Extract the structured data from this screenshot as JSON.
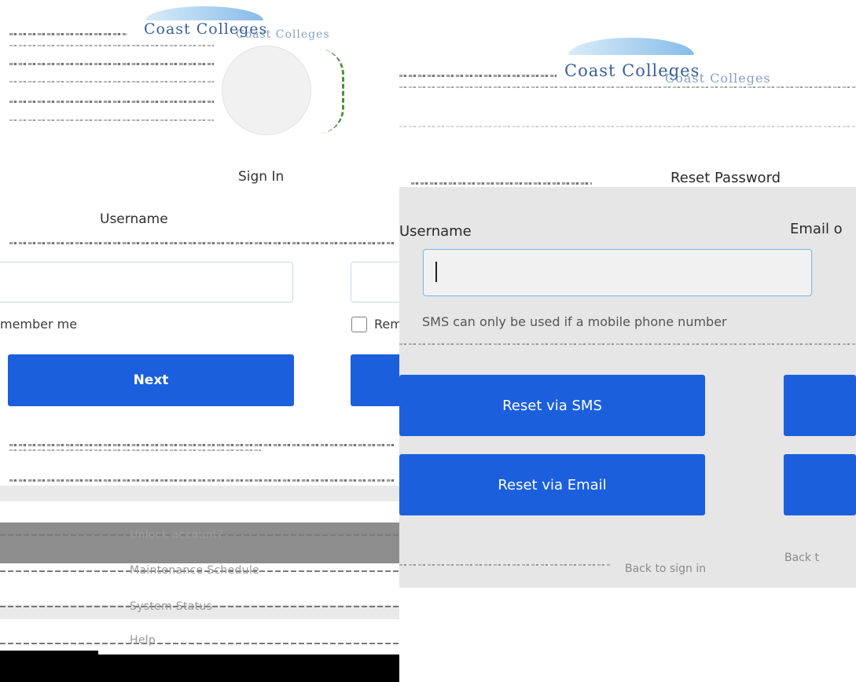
{
  "left": {
    "logo_text": "Coast Colleges",
    "logo_echo": "Coast Colleges",
    "heading": "Sign In",
    "username_label": "Username",
    "remember_text": "member me",
    "remember_text_2": "Rem",
    "next_label": "Next",
    "footer_links": [
      "Unlock account?",
      "Maintenance Schedule",
      "System Status",
      "Help"
    ]
  },
  "right": {
    "logo_text": "Coast Colleges",
    "logo_echo": "Coast Colleges",
    "title": "Reset Password",
    "username_label": "Username",
    "email_label": "Email o",
    "sms_note": "SMS can only be used if a mobile phone number",
    "reset_sms_label": "Reset via SMS",
    "reset_email_label": "Reset via Email",
    "back_label": "Back to sign in",
    "back_label_2": "Back t"
  },
  "colors": {
    "primary_blue": "#1b5fdc",
    "card_gray": "#e6e6e6",
    "logo_navy": "#3a5f9a"
  }
}
